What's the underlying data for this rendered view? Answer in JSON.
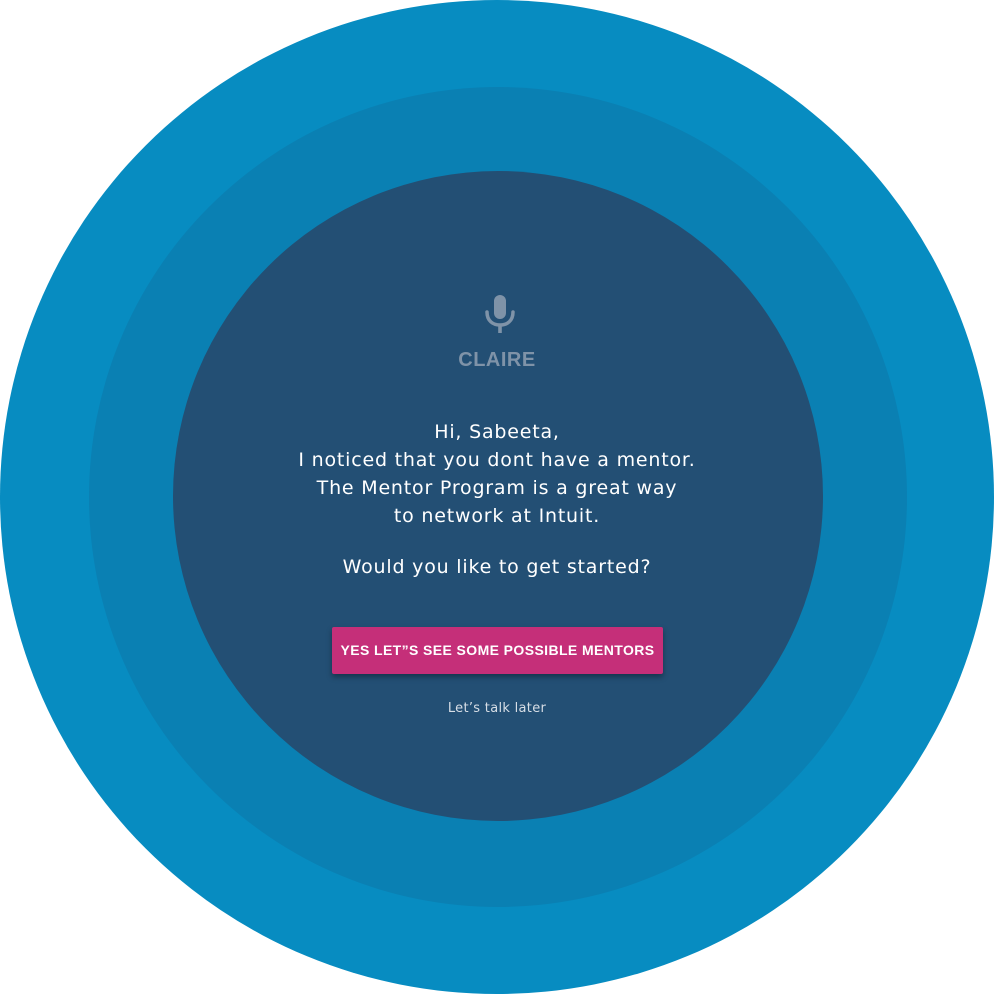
{
  "colors": {
    "outer_ring": "#078cc1",
    "middle_ring": "#0a80b3",
    "inner_circle": "#234f74",
    "assistant_name": "#7f93a8",
    "button_bg": "#c52f79",
    "text": "#ffffff"
  },
  "assistant": {
    "icon": "microphone-icon",
    "name": "CLAIRE"
  },
  "message": {
    "lines": [
      "Hi, Sabeeta,",
      "I noticed that you dont have a mentor.",
      "The Mentor Program is a great way",
      "to network at Intuit."
    ],
    "question": "Would you like to get started?"
  },
  "actions": {
    "primary_label": "YES LET”S SEE SOME POSSIBLE MENTORS",
    "secondary_label": "Let’s talk later"
  }
}
